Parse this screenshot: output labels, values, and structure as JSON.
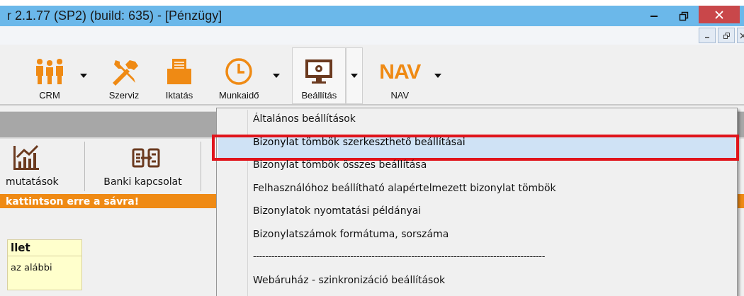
{
  "window": {
    "title": "r 2.1.77 (SP2) (build: 635) - [Pénzügy]"
  },
  "toolbar": [
    {
      "kind": "people",
      "label": "CRM",
      "has_dropdown": true,
      "pressed": false
    },
    {
      "kind": "tools",
      "label": "Szerviz",
      "has_dropdown": false,
      "pressed": false
    },
    {
      "kind": "folder",
      "label": "Iktatás",
      "has_dropdown": false,
      "pressed": false
    },
    {
      "kind": "clock",
      "label": "Munkaidő",
      "has_dropdown": true,
      "pressed": false
    },
    {
      "kind": "monitor",
      "label": "Beállítás",
      "has_dropdown": true,
      "pressed": true
    },
    {
      "kind": "text",
      "icon_text": "NAV",
      "label": "NAV",
      "has_dropdown": true,
      "pressed": false
    }
  ],
  "module_toolbar": [
    {
      "kind": "chart",
      "label": "mutatások"
    },
    {
      "kind": "transfer",
      "label": "Banki kapcsolat"
    }
  ],
  "notice_bar": {
    "text": "kattintson erre a sávra!"
  },
  "side_panel": {
    "title": "llet",
    "text": "az alábbi"
  },
  "menu": {
    "items": [
      {
        "kind": "item",
        "label": "Általános beállítások",
        "selected": false,
        "marked": false
      },
      {
        "kind": "item",
        "label": "Bizonylat tömbök szerkeszthető beállításai",
        "selected": true,
        "marked": true
      },
      {
        "kind": "item",
        "label": "Bizonylat tömbök összes beállítása",
        "selected": false,
        "marked": false
      },
      {
        "kind": "item",
        "label": "Felhasználóhoz beállítható alapértelmezett bizonylat tömbök",
        "selected": false,
        "marked": false
      },
      {
        "kind": "item",
        "label": "Bizonylatok nyomtatási példányai",
        "selected": false,
        "marked": false
      },
      {
        "kind": "item",
        "label": "Bizonylatszámok formátuma, sorszáma",
        "selected": false,
        "marked": false
      },
      {
        "kind": "separator",
        "label": "------------------------------------------------------------------------------------------------"
      },
      {
        "kind": "item",
        "label": "Webáruház - szinkronizáció beállítások",
        "selected": false,
        "marked": false
      }
    ]
  }
}
